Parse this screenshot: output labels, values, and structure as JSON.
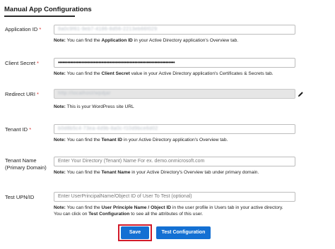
{
  "section": {
    "title": "Manual App Configurations"
  },
  "fields": [
    {
      "label": "Application ID",
      "required": "*",
      "value": "9a0c9f61-9eb7-4186-8d56-2213eb66f029",
      "note_prefix": "Note:",
      "note_pre": " You can find the ",
      "note_bold": "Application ID",
      "note_post": " in your Active Directory application's Overview tab."
    },
    {
      "label": "Client Secret",
      "required": "*",
      "value": "•••••••••••••••••••••••••••••••••••••••••••••••••••••••••••••••••••••••••••",
      "note_prefix": "Note:",
      "note_pre": " You can find the ",
      "note_bold": "Client Secret",
      "note_post": " value in your Active Directory application's Certificates & Secrets tab."
    },
    {
      "label": "Redirect URI",
      "required": "*",
      "value": "http://localhost/wpdjar",
      "note_prefix": "Note:",
      "note_text": " This is your WordPress site URL"
    },
    {
      "label": "Tenant ID",
      "required": "*",
      "value": "b0d8b5c4-73ea-4d9b-8a0c-f10d9bce6d02",
      "note_prefix": "Note:",
      "note_pre": " You can find the ",
      "note_bold": "Tenant ID",
      "note_post": " in your Active Directory application's Overview tab."
    },
    {
      "label": "Tenant Name (Primary Domain)",
      "placeholder": "Enter Your Directory (Tenant) Name For ex. demo.onmicrosoft.com",
      "note_prefix": "Note:",
      "note_pre": " You can find the ",
      "note_bold": "Tenant Name",
      "note_post": " in your Active Directory's Overview tab under primary domain."
    },
    {
      "label": "Test UPN/ID",
      "placeholder": "Enter UserPrincipalName/Object ID of User To Test (optional)",
      "note_prefix": "Note:",
      "note_pre": " You can find the ",
      "note_bold": "User Principle Name / Object ID",
      "note_post": " in the user profile in Users tab in your active directory.",
      "note_line2_pre": "You can click on ",
      "note_line2_bold": "Test Configuration",
      "note_line2_post": " to see all the attributes of this user."
    }
  ],
  "buttons": {
    "save": "Save",
    "test": "Test Configuration"
  },
  "icons": {
    "edit": "pencil-icon"
  },
  "colors": {
    "primary": "#1470d3",
    "required": "#d92b2b",
    "highlight": "#d11a2a"
  }
}
